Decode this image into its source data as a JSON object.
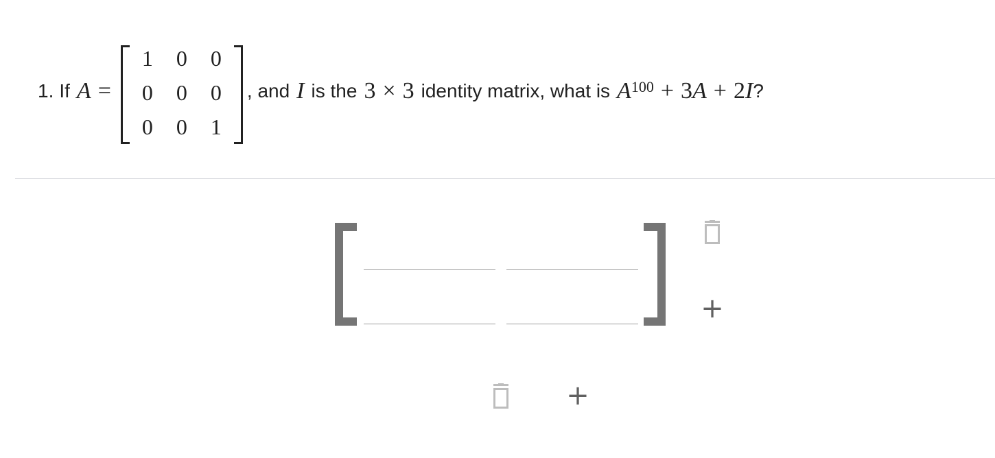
{
  "question": {
    "number": "1.",
    "if_word": "If",
    "var_a": "A",
    "equals": "=",
    "matrix": [
      [
        "1",
        "0",
        "0"
      ],
      [
        "0",
        "0",
        "0"
      ],
      [
        "0",
        "0",
        "1"
      ]
    ],
    "and_text": ", and",
    "var_i": "I",
    "is_the": "is the",
    "dim_n1": "3",
    "times": "×",
    "dim_n2": "3",
    "identity_text": "identity matrix, what is",
    "power_base": "A",
    "power_exp": "100",
    "plus1": "+",
    "coef_3": "3",
    "term_a": "A",
    "plus2": "+",
    "coef_2": "2",
    "term_i": "I",
    "qmark": "?"
  },
  "answer": {
    "cells": [
      [
        "",
        ""
      ],
      [
        "",
        ""
      ]
    ],
    "delete_row_icon": "trash-icon",
    "add_row_icon": "plus-icon",
    "delete_column_icon": "trash-icon",
    "add_column_icon": "plus-icon",
    "add_symbol": "+"
  },
  "colors": {
    "bracket": "#757575",
    "text": "#212121",
    "divider": "#dadce0",
    "icon_disabled": "#bdbdbd",
    "icon_active": "#616161"
  }
}
